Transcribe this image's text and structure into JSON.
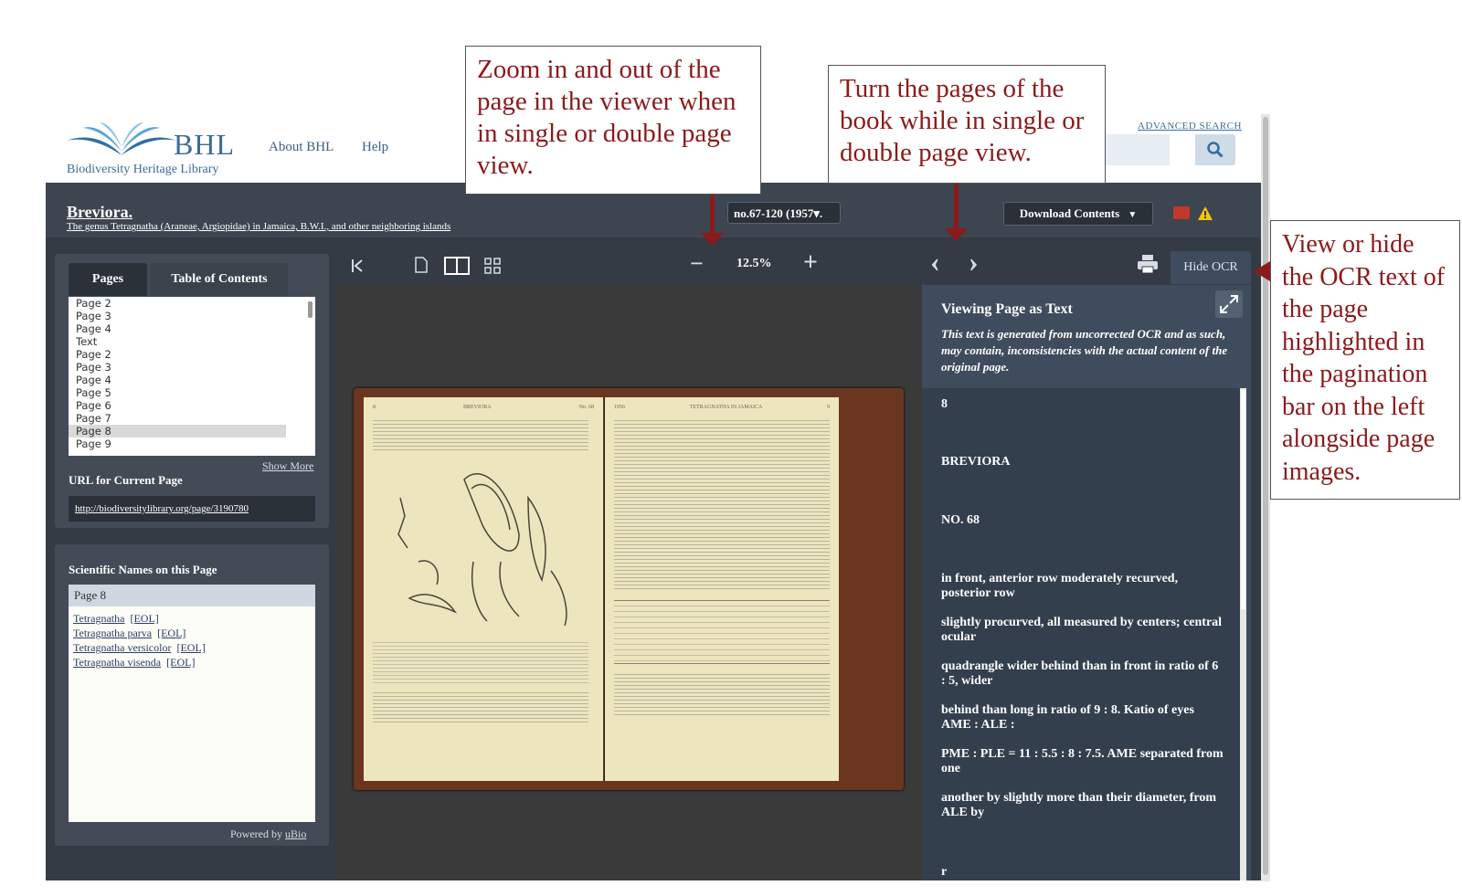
{
  "brand": {
    "logo_text": "BHL",
    "subtitle": "Biodiversity Heritage Library"
  },
  "top_nav": {
    "about": "About BHL",
    "help": "Help",
    "advanced_search": "ADVANCED SEARCH"
  },
  "book": {
    "title": "Breviora.",
    "subtitle": "The genus Tetragnatha (Araneae, Argiopidae) in Jamaica, B.W.I., and other neighboring islands",
    "volume": "no.67-120 (1957▾.",
    "download_label": "Download Contents",
    "download_caret": "▼"
  },
  "left_panel": {
    "tabs": [
      "Pages",
      "Table of Contents"
    ],
    "pages": [
      "Page 2",
      "Page 3",
      "Page 4",
      "Text",
      "Page 2",
      "Page 3",
      "Page 4",
      "Page 5",
      "Page 6",
      "Page 7",
      "Page 8",
      "Page 9"
    ],
    "selected_page": "Page 8",
    "show_more": "Show More",
    "url_label": "URL for Current Page",
    "url_value": "http://biodiversitylibrary.org/page/3190780"
  },
  "sci_names": {
    "heading": "Scientific Names on this Page",
    "page": "Page 8",
    "names": [
      {
        "name": "Tetragnatha",
        "link": "[EOL]"
      },
      {
        "name": "Tetragnatha parva",
        "link": "[EOL]"
      },
      {
        "name": "Tetragnatha versicolor",
        "link": "[EOL]"
      },
      {
        "name": "Tetragnatha visenda",
        "link": "[EOL]"
      }
    ],
    "powered_prefix": "Powered by",
    "powered_link": "uBio"
  },
  "toolbar": {
    "zoom_value": "12.5%",
    "zoom_out": "−",
    "zoom_in": "+",
    "prev": "‹",
    "next": "›",
    "hide_ocr": "Hide OCR"
  },
  "page_scan": {
    "left_header": [
      "8",
      "BREVIORA",
      "No. 68"
    ],
    "right_header": [
      "1956",
      "TETRAGNATHA IN JAMAICA",
      "9"
    ]
  },
  "ocr": {
    "heading": "Viewing Page as Text",
    "note": "This text is generated from uncorrected OCR and as such, may contain, inconsistencies with the actual content of the original page.",
    "lines": [
      "8",
      "BREVIORA",
      "NO. 68",
      "in front, anterior row moderately recurved, posterior row",
      "slightly procurved, all measured by centers; central ocular",
      "quadrangle wider behind than in front in ratio of 6 : 5, wider",
      "behind than long in ratio of 9 : 8. Katio of eyes AME : ALE :",
      "PME : PLE = 11 : 5.5 : 8 : 7.5. AME separated from one",
      "another by slightly more than their diameter, from ALE by",
      "r"
    ]
  },
  "callouts": {
    "zoom": "Zoom in and out of the page in the viewer when in single or double page view.",
    "turn": "Turn the pages of the book while in single or double page view.",
    "ocr": "View or hide the OCR text of the page highlighted in the pagination bar on the left alongside page images."
  },
  "colors": {
    "accent": "#8b1a1a",
    "panel": "#434b56",
    "brand": "#3b6c9a"
  }
}
